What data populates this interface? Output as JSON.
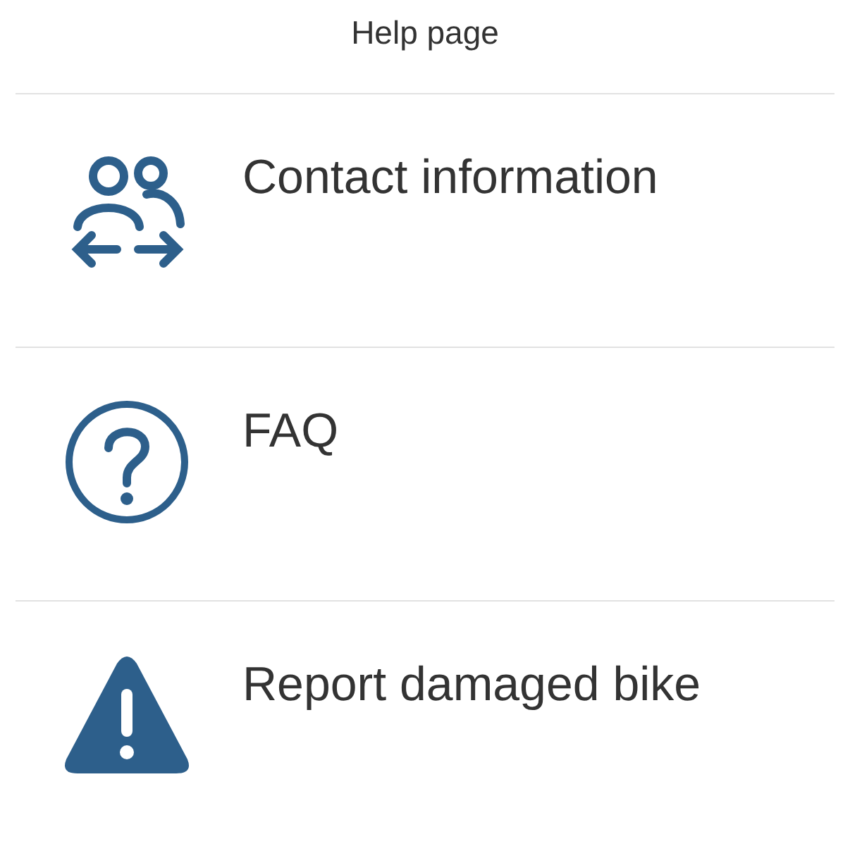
{
  "header": {
    "title": "Help page"
  },
  "items": [
    {
      "kind": "contacts",
      "label": "Contact information"
    },
    {
      "kind": "faq",
      "label": "FAQ"
    },
    {
      "kind": "warning",
      "label": "Report damaged bike"
    }
  ]
}
